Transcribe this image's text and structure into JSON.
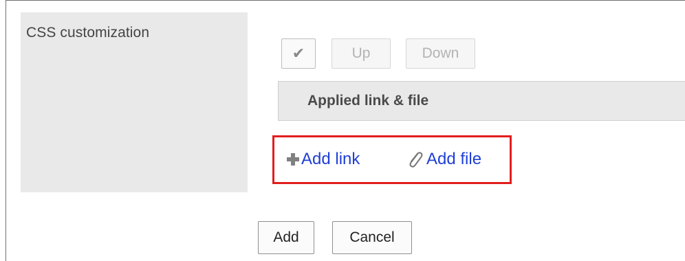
{
  "setting": {
    "label": "CSS customization"
  },
  "toolbar": {
    "check_label": "✔",
    "up_label": "Up",
    "down_label": "Down"
  },
  "applied": {
    "header": "Applied link & file"
  },
  "actions": {
    "add_link_label": "Add link",
    "add_file_label": "Add file",
    "add_link_icon": "plus-icon",
    "add_file_icon": "paperclip-icon"
  },
  "footer": {
    "add_label": "Add",
    "cancel_label": "Cancel"
  },
  "colors": {
    "link": "#1f3fd6",
    "highlight": "#e21d1d",
    "label_bg": "#e9e9e9"
  }
}
